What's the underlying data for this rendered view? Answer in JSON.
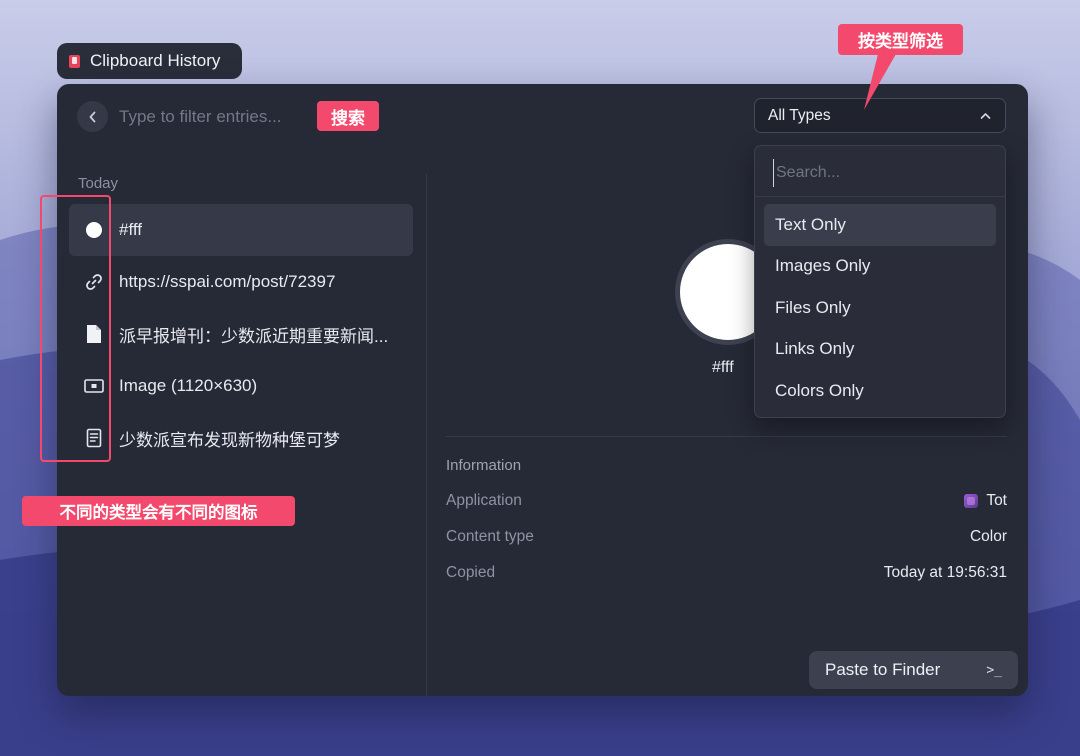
{
  "window": {
    "title": "Clipboard History"
  },
  "search": {
    "placeholder": "Type to filter entries..."
  },
  "filter": {
    "selected": "All Types",
    "dropdown_placeholder": "Search...",
    "options": [
      "Text Only",
      "Images Only",
      "Files Only",
      "Links Only",
      "Colors Only"
    ],
    "highlighted_index": 0
  },
  "list": {
    "section": "Today",
    "items": [
      {
        "icon": "color-dot-icon",
        "text": "#fff"
      },
      {
        "icon": "link-icon",
        "text": "https://sspai.com/post/72397"
      },
      {
        "icon": "file-icon",
        "text": "派早报增刊：少数派近期重要新闻..."
      },
      {
        "icon": "image-icon",
        "text": "Image (1120×630)"
      },
      {
        "icon": "text-document-icon",
        "text": "少数派宣布发现新物种堡可梦"
      }
    ],
    "selected_index": 0
  },
  "preview": {
    "label": "#fff",
    "color": "#ffffff"
  },
  "info": {
    "title": "Information",
    "rows": [
      {
        "key": "Application",
        "value": "Tot"
      },
      {
        "key": "Content type",
        "value": "Color"
      },
      {
        "key": "Copied",
        "value": "Today at 19:56:31"
      }
    ]
  },
  "action": {
    "label": "Paste to Finder",
    "shortcut": ">_"
  },
  "annotations": {
    "search": "搜索",
    "filter": "按类型筛选",
    "icons": "不同的类型会有不同的图标",
    "color": "#f2496c"
  }
}
